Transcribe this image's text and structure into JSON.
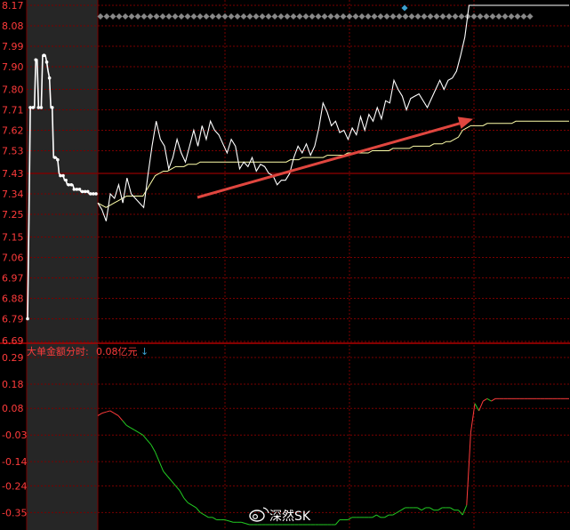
{
  "chart_data": [
    {
      "type": "line",
      "panel": "price",
      "yticks": [
        "8.17",
        "8.08",
        "7.99",
        "7.90",
        "7.80",
        "7.71",
        "7.62",
        "7.53",
        "7.43",
        "7.34",
        "7.25",
        "7.15",
        "7.06",
        "6.97",
        "6.88",
        "6.79",
        "6.69"
      ],
      "ylim": [
        6.69,
        8.17
      ],
      "prev_close": 7.43,
      "grid": true,
      "series": [
        {
          "color": "#ffffff",
          "label_color": "#ffffff",
          "part": "pre-auction",
          "x": [
            0,
            0.02,
            0.04,
            0.06,
            0.08,
            0.1,
            0.12,
            0.14,
            0.16,
            0.18,
            0.2,
            0.22,
            0.24,
            0.26,
            0.28,
            0.3,
            0.32,
            0.34,
            0.36,
            0.38,
            0.4,
            0.42,
            0.44,
            0.46,
            0.48,
            0.5,
            0.52,
            0.54,
            0.56,
            0.58,
            0.6,
            0.62,
            0.64,
            0.66,
            0.68,
            0.7,
            0.72,
            0.74,
            0.76,
            0.78,
            0.8,
            0.82,
            0.84,
            0.86,
            0.88,
            0.9,
            0.92,
            0.94,
            0.96,
            0.98,
            1.0
          ],
          "values": [
            6.79,
            7.22,
            7.72,
            7.72,
            7.72,
            7.72,
            7.93,
            7.93,
            7.72,
            7.72,
            7.72,
            7.95,
            7.95,
            7.95,
            7.92,
            7.88,
            7.85,
            7.72,
            7.72,
            7.5,
            7.5,
            7.5,
            7.49,
            7.43,
            7.42,
            7.42,
            7.42,
            7.4,
            7.4,
            7.38,
            7.38,
            7.38,
            7.38,
            7.38,
            7.36,
            7.36,
            7.36,
            7.36,
            7.36,
            7.35,
            7.35,
            7.35,
            7.35,
            7.35,
            7.35,
            7.34,
            7.34,
            7.34,
            7.34,
            7.34,
            7.34
          ]
        },
        {
          "color": "#ffffff",
          "part": "price",
          "values": [
            7.3,
            7.27,
            7.22,
            7.34,
            7.32,
            7.38,
            7.3,
            7.41,
            7.34,
            7.32,
            7.3,
            7.28,
            7.42,
            7.55,
            7.66,
            7.58,
            7.55,
            7.45,
            7.5,
            7.58,
            7.52,
            7.48,
            7.55,
            7.62,
            7.55,
            7.64,
            7.58,
            7.66,
            7.62,
            7.6,
            7.56,
            7.52,
            7.58,
            7.55,
            7.45,
            7.48,
            7.46,
            7.5,
            7.44,
            7.47,
            7.46,
            7.43,
            7.42,
            7.38,
            7.4,
            7.4,
            7.43,
            7.5,
            7.55,
            7.52,
            7.56,
            7.51,
            7.55,
            7.63,
            7.74,
            7.7,
            7.64,
            7.66,
            7.61,
            7.62,
            7.58,
            7.63,
            7.6,
            7.68,
            7.62,
            7.69,
            7.66,
            7.72,
            7.67,
            7.75,
            7.74,
            7.84,
            7.8,
            7.77,
            7.71,
            7.76,
            7.77,
            7.78,
            7.75,
            7.72,
            7.76,
            7.8,
            7.84,
            7.8,
            7.84,
            7.85,
            7.88,
            7.95,
            8.03,
            8.17,
            8.17,
            8.17,
            8.17,
            8.17,
            8.17,
            8.17,
            8.17,
            8.17,
            8.17,
            8.17,
            8.17,
            8.17,
            8.17,
            8.17,
            8.17,
            8.17,
            8.17,
            8.17,
            8.17,
            8.17,
            8.17,
            8.17,
            8.17,
            8.17
          ]
        },
        {
          "color": "#ffffaa",
          "part": "average",
          "values": [
            7.3,
            7.29,
            7.28,
            7.29,
            7.3,
            7.31,
            7.32,
            7.33,
            7.33,
            7.33,
            7.33,
            7.33,
            7.36,
            7.39,
            7.42,
            7.43,
            7.44,
            7.44,
            7.45,
            7.46,
            7.46,
            7.46,
            7.47,
            7.47,
            7.47,
            7.48,
            7.48,
            7.48,
            7.48,
            7.48,
            7.48,
            7.48,
            7.48,
            7.48,
            7.48,
            7.48,
            7.48,
            7.48,
            7.48,
            7.48,
            7.48,
            7.48,
            7.48,
            7.48,
            7.48,
            7.48,
            7.48,
            7.49,
            7.49,
            7.49,
            7.5,
            7.5,
            7.5,
            7.5,
            7.5,
            7.5,
            7.51,
            7.51,
            7.51,
            7.51,
            7.51,
            7.52,
            7.52,
            7.52,
            7.52,
            7.52,
            7.52,
            7.53,
            7.53,
            7.53,
            7.53,
            7.53,
            7.54,
            7.54,
            7.54,
            7.54,
            7.54,
            7.55,
            7.55,
            7.55,
            7.55,
            7.55,
            7.56,
            7.56,
            7.56,
            7.57,
            7.57,
            7.58,
            7.59,
            7.62,
            7.63,
            7.64,
            7.64,
            7.64,
            7.64,
            7.65,
            7.65,
            7.65,
            7.65,
            7.65,
            7.65,
            7.65,
            7.66,
            7.66,
            7.66,
            7.66,
            7.66,
            7.66,
            7.66,
            7.66,
            7.66,
            7.66,
            7.66,
            7.66,
            7.66,
            7.66
          ]
        }
      ],
      "annotations": [
        {
          "type": "arrow",
          "color": "#e0463f",
          "from": [
            0.02,
            7.26
          ],
          "to": [
            0.38,
            7.67
          ]
        }
      ],
      "markers": {
        "color": "#888888",
        "highlight": "#3aa0d0"
      }
    },
    {
      "type": "line",
      "panel": "indicator",
      "label": "大单金额分时:",
      "value_text": "0.08亿元",
      "arrow_glyph": "↓",
      "yticks": [
        "0.29",
        "0.18",
        "0.08",
        "-0.03",
        "-0.14",
        "-0.24",
        "-0.35"
      ],
      "ylim": [
        -0.4,
        0.29
      ],
      "series": [
        {
          "color_up": "#ff3b3b",
          "color_down": "#22cc22",
          "values": [
            0.05,
            0.06,
            0.065,
            0.07,
            0.06,
            0.05,
            0.03,
            0.01,
            0.0,
            -0.01,
            -0.02,
            -0.03,
            -0.05,
            -0.07,
            -0.1,
            -0.14,
            -0.18,
            -0.2,
            -0.22,
            -0.24,
            -0.26,
            -0.29,
            -0.31,
            -0.32,
            -0.33,
            -0.35,
            -0.36,
            -0.37,
            -0.37,
            -0.38,
            -0.38,
            -0.38,
            -0.385,
            -0.39,
            -0.39,
            -0.39,
            -0.395,
            -0.4,
            -0.4,
            -0.4,
            -0.4,
            -0.4,
            -0.4,
            -0.4,
            -0.4,
            -0.4,
            -0.4,
            -0.4,
            -0.4,
            -0.4,
            -0.4,
            -0.4,
            -0.4,
            -0.4,
            -0.4,
            -0.4,
            -0.4,
            -0.4,
            -0.4,
            -0.38,
            -0.38,
            -0.38,
            -0.37,
            -0.37,
            -0.37,
            -0.37,
            -0.37,
            -0.37,
            -0.36,
            -0.37,
            -0.37,
            -0.36,
            -0.36,
            -0.35,
            -0.34,
            -0.33,
            -0.33,
            -0.33,
            -0.33,
            -0.34,
            -0.33,
            -0.33,
            -0.34,
            -0.34,
            -0.33,
            -0.33,
            -0.33,
            -0.34,
            -0.34,
            -0.36,
            -0.32,
            -0.02,
            0.1,
            0.07,
            0.11,
            0.12,
            0.11,
            0.12,
            0.12,
            0.12,
            0.12,
            0.12,
            0.12,
            0.12,
            0.12,
            0.12,
            0.12,
            0.12,
            0.12,
            0.12,
            0.12,
            0.12,
            0.12,
            0.12,
            0.12,
            0.12
          ]
        }
      ]
    }
  ],
  "watermark": {
    "text": "深然SK"
  }
}
